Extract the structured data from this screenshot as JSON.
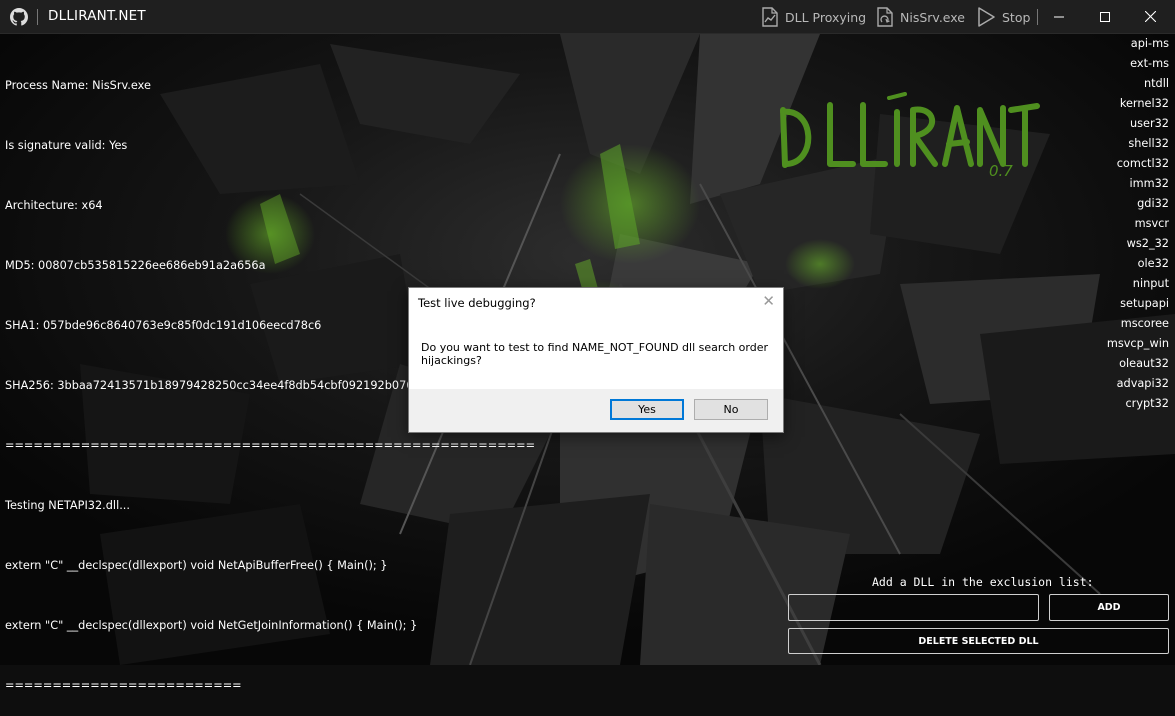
{
  "titlebar": {
    "app_title": "DLLIRANT.NET",
    "actions": [
      {
        "label": "DLL Proxying",
        "icon": "file-chart-icon"
      },
      {
        "label": "NisSrv.exe",
        "icon": "file-sync-icon"
      },
      {
        "label": "Stop",
        "icon": "play-icon"
      }
    ],
    "window_controls": [
      "minimize",
      "maximize",
      "close"
    ]
  },
  "info": {
    "lines": [
      "Process Name: NisSrv.exe",
      "Is signature valid: Yes",
      "Architecture: x64",
      "MD5: 00807cb535815226ee686eb91a2a656a",
      "SHA1: 057bde96c8640763e9c85f0dc191d106eecd78c6",
      "SHA256: 3bbaa72413571b18979428250cc34ee4f8db54cbf092192b076aeaaeb66e2bcd",
      "========================================================",
      "Testing NETAPI32.dll...",
      "extern \"C\" __declspec(dllexport) void NetApiBufferFree() { Main(); }",
      "extern \"C\" __declspec(dllexport) void NetGetJoinInformation() { Main(); }",
      "========================="
    ]
  },
  "dll_list": [
    "api-ms",
    "ext-ms",
    "ntdll",
    "kernel32",
    "user32",
    "shell32",
    "comctl32",
    "imm32",
    "gdi32",
    "msvcr",
    "ws2_32",
    "ole32",
    "ninput",
    "setupapi",
    "mscoree",
    "msvcp_win",
    "oleaut32",
    "advapi32",
    "crypt32"
  ],
  "logo": {
    "text": "DLLIRANT",
    "version": "0.7",
    "color": "#4a8a1c"
  },
  "dialog": {
    "title": "Test live debugging?",
    "message": "Do you want to test to find NAME_NOT_FOUND dll search order hijackings?",
    "yes_label": "Yes",
    "no_label": "No"
  },
  "exclusion": {
    "label": "Add a DLL in the exclusion list:",
    "input_value": "",
    "add_label": "ADD",
    "delete_label": "DELETE SELECTED DLL"
  }
}
